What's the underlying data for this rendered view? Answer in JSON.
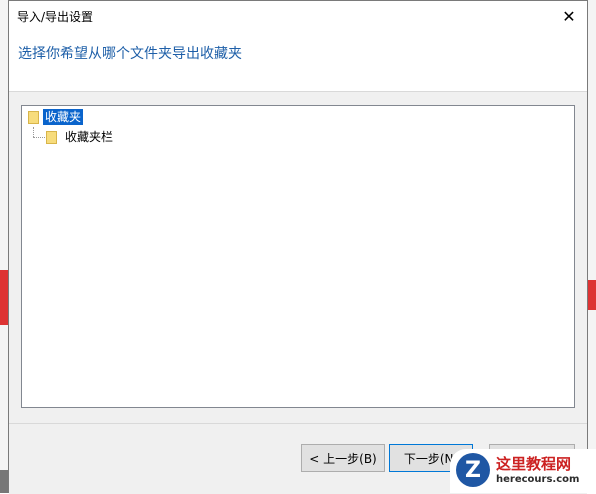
{
  "dialog": {
    "title": "导入/导出设置",
    "close_glyph": "✕",
    "heading": "选择你希望从哪个文件夹导出收藏夹"
  },
  "tree": {
    "root": {
      "label": "收藏夹",
      "selected": true
    },
    "child": {
      "label": "收藏夹栏"
    }
  },
  "buttons": {
    "back": "< 上一步(B)",
    "next": "下一步(N)"
  },
  "watermark": {
    "logo_letter": "Z",
    "title": "这里教程网",
    "subtitle": "herecours.com"
  },
  "colors": {
    "heading": "#1e5fa8",
    "selection": "#0a64cc",
    "folder": "#f7dc7c"
  }
}
